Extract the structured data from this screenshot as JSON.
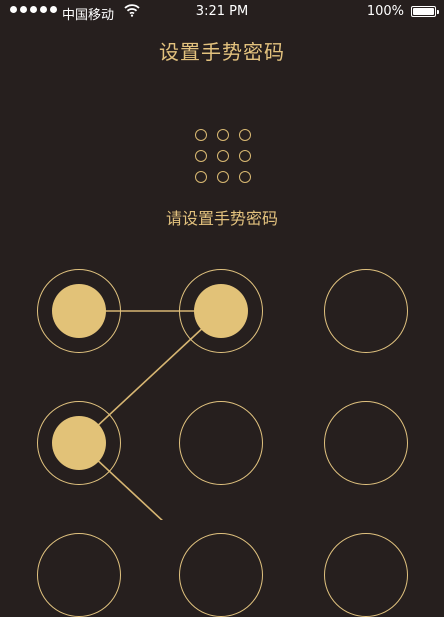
{
  "status_bar": {
    "carrier": "中国移动",
    "time": "3:21 PM",
    "battery": "100%",
    "battery_level": 1.0,
    "signal_bars": 5
  },
  "title": "设置手势密码",
  "prompt": "请设置手势密码",
  "colors": {
    "background": "#261f1e",
    "accent": "#e3c27e",
    "status_text": "#ffffff"
  },
  "preview": {
    "rows": 3,
    "cols": 3
  },
  "gesture_pad": {
    "rows": 3,
    "cols": 3,
    "selected_nodes": [
      0,
      1,
      3
    ],
    "path_order": [
      0,
      1,
      3,
      7
    ]
  }
}
